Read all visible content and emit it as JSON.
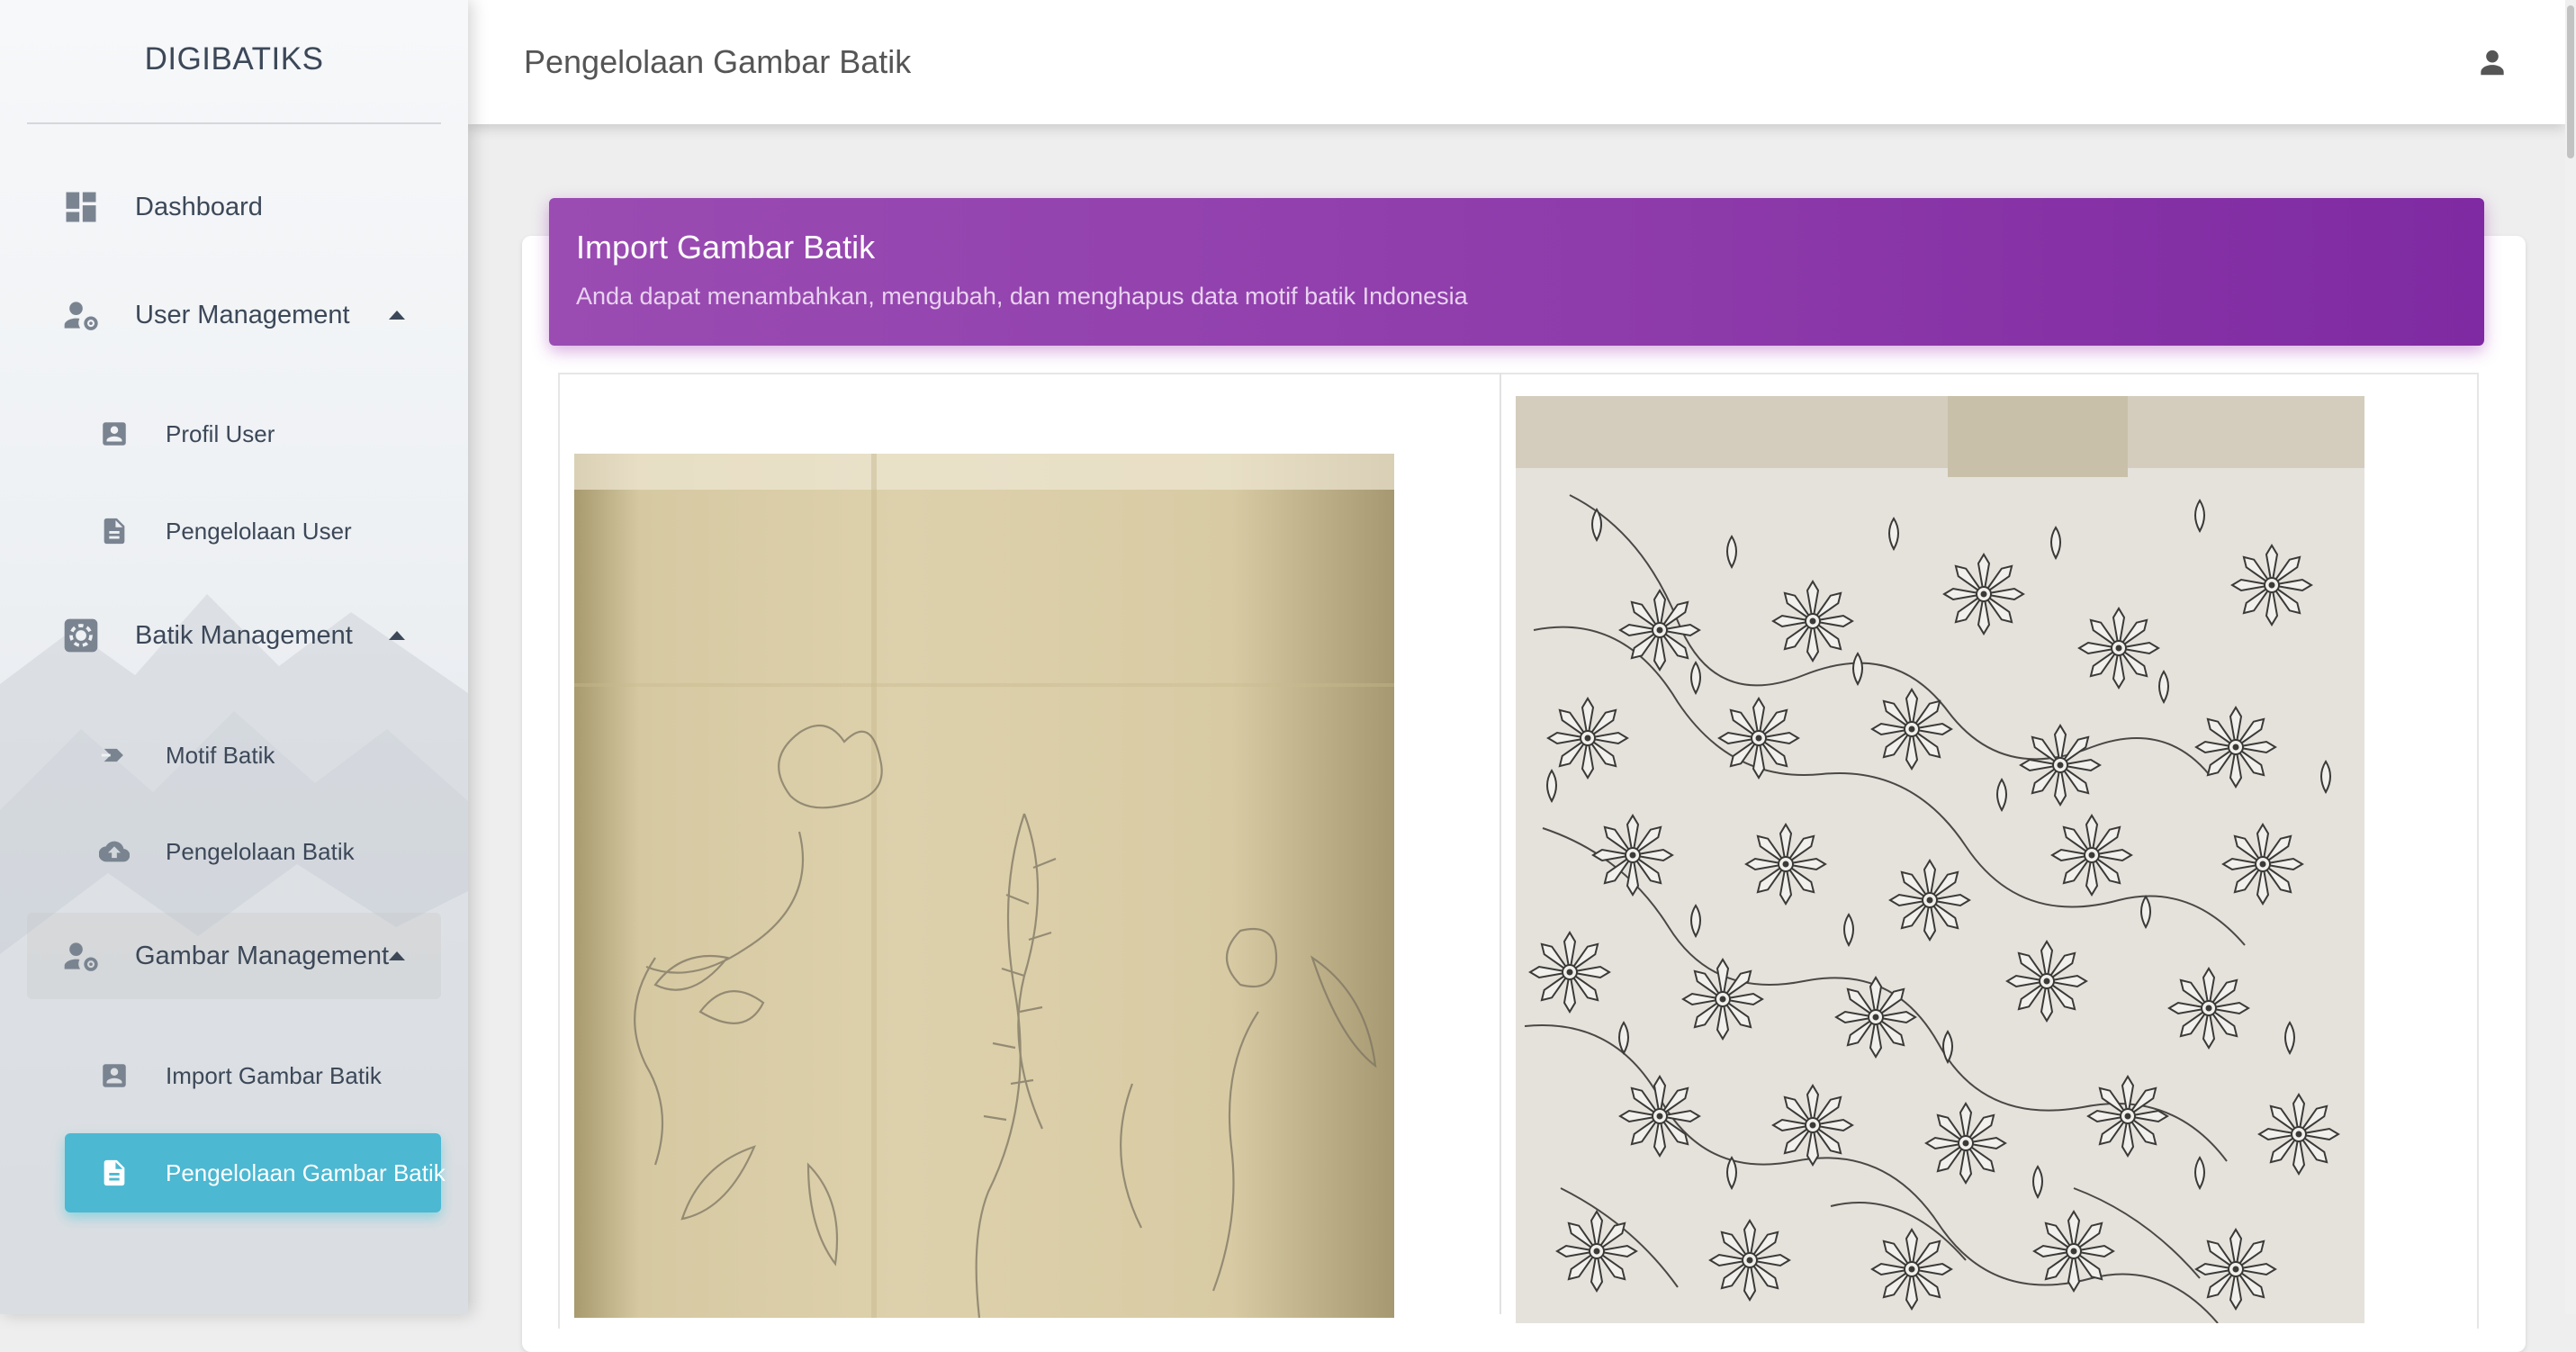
{
  "brand": "DIGIBATIKS",
  "sidebar": {
    "items": [
      {
        "label": "Dashboard",
        "icon": "dashboard-icon"
      },
      {
        "label": "User Management",
        "icon": "manage-accounts-icon"
      },
      {
        "label": "Batik Management",
        "icon": "settings-box-icon"
      },
      {
        "label": "Gambar Management",
        "icon": "manage-accounts-icon"
      }
    ],
    "user_sub": [
      {
        "label": "Profil User",
        "icon": "account-box-icon"
      },
      {
        "label": "Pengelolaan User",
        "icon": "description-icon"
      }
    ],
    "batik_sub": [
      {
        "label": "Motif Batik",
        "icon": "forward-arrow-icon"
      },
      {
        "label": "Pengelolaan Batik",
        "icon": "cloud-upload-icon"
      }
    ],
    "gambar_sub": [
      {
        "label": "Import Gambar Batik",
        "icon": "account-box-icon"
      },
      {
        "label": "Pengelolaan Gambar Batik",
        "icon": "description-icon",
        "active": true
      }
    ]
  },
  "header": {
    "title": "Pengelolaan Gambar Batik",
    "user_icon": "person-icon"
  },
  "card": {
    "title": "Import Gambar Batik",
    "subtitle": "Anda dapat menambahkan, mengubah, dan menghapus data motif batik Indonesia"
  },
  "colors": {
    "accent": "#9a4cb2",
    "active": "#4cb8d2",
    "text": "#3c4858"
  }
}
